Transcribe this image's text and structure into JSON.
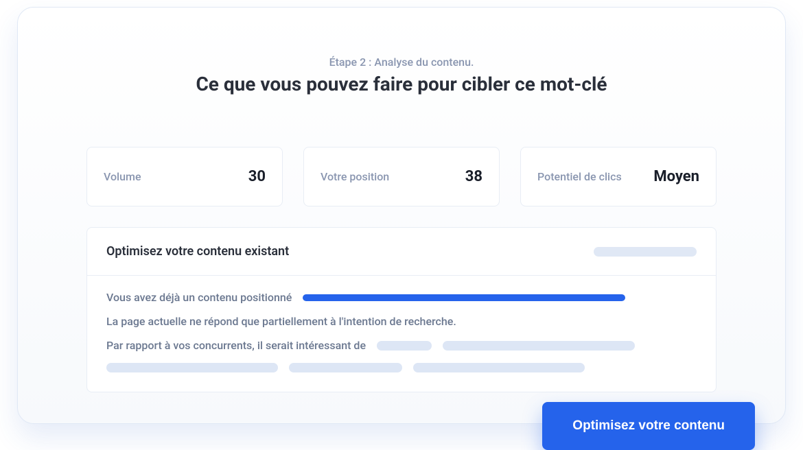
{
  "header": {
    "step_label": "Étape 2 : Analyse du contenu.",
    "title": "Ce que vous pouvez faire pour cibler ce mot-clé"
  },
  "stats": {
    "volume": {
      "label": "Volume",
      "value": "30"
    },
    "position": {
      "label": "Votre position",
      "value": "38"
    },
    "potential": {
      "label": "Potentiel de clics",
      "value": "Moyen"
    }
  },
  "panel": {
    "title": "Optimisez votre contenu existant",
    "line1": "Vous avez déjà un contenu positionné",
    "line2": "La page actuelle ne répond que partiellement à l'intention de recherche.",
    "line3": "Par rapport à vos concurrents, il serait intéressant de"
  },
  "cta": {
    "label": "Optimisez votre contenu"
  }
}
